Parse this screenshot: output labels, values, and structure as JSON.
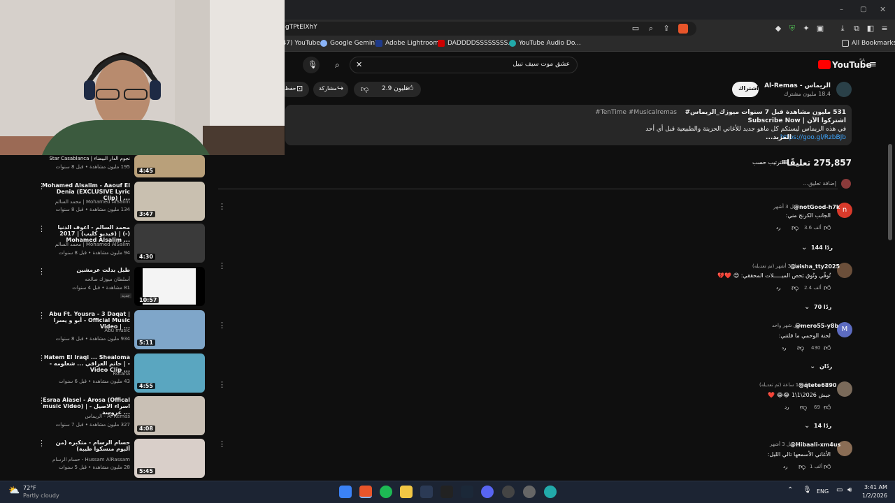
{
  "browser": {
    "url": "gTPtElXhY",
    "bookmarks": [
      {
        "label": "(47) YouTube",
        "color": "#ff0000"
      },
      {
        "label": "Google Gemini",
        "color": "#8ab4f8"
      },
      {
        "label": "Adobe Lightroom",
        "color": "#1e3a8a"
      },
      {
        "label": "DADDDDSSSSSSSS...",
        "color": "#c00"
      },
      {
        "label": "YouTube Audio Do...",
        "color": "#2aa"
      }
    ],
    "all_bookmarks": "All Bookmarks"
  },
  "yt_header": {
    "logo_text": "YouTube",
    "region": "SA",
    "search_value": "عشق موت سيف نبيل",
    "search_icon": "search-icon"
  },
  "channel": {
    "name": "الريماس - Al-Remas",
    "subscribers": "18.4 مليون مشترك",
    "subscribe_label": "اشتراك",
    "likes": "2.9 مليون",
    "share_label": "مشاركة",
    "save_label": "حفظ"
  },
  "description": {
    "stats": "531 مليون مشاهدة  قبل 7 سنوات  ميوزك_الريماس#",
    "hashtags": "#TenTime #Musicalremas",
    "line2": "اشتركوا الآن | Subscribe Now",
    "line3": "في هذه الريماس ليستكم كل ماهو جديد للأغاني الحزينة والطبيعية قبل أي أحد",
    "link": "https://goo.gl/RzbBJb",
    "more": "...المزيد"
  },
  "comments_header": {
    "count": "275,857 تعليقًا",
    "sort_label": "الترتيب حسب",
    "add_placeholder": "إضافة تعليق..."
  },
  "comments": [
    {
      "author": "@notGood-h7k",
      "time": "قبل 3 أشهر",
      "text": "الجانب الكرنج مني:",
      "likes": "3.6 ألف",
      "replies": "144 ردًا",
      "avatar_letter": "n",
      "avatar_color": "#d93a2b"
    },
    {
      "author": "@aisha_tty2025",
      "time": "قبل 3 أشهر (تم تعديله)",
      "text": "تُوفّي وتُوق بَحص الميـــــلات المحققي: 😍 ❤️💔",
      "likes": "2.4 ألف",
      "replies": "70 ردًا",
      "avatar_letter": "",
      "avatar_color": "#6b4f3a"
    },
    {
      "author": "@mero55-y8b",
      "time": "قبل شهر واحد",
      "text": "لحنة الوحمي ما قلتني:",
      "likes": "430",
      "replies": "ردّان",
      "avatar_letter": "M",
      "avatar_color": "#5c6bc0"
    },
    {
      "author": "@qtete6890",
      "time": "قبل 13 ساعة (تم تعديله)",
      "text": "جيش 2026\\1\\1 😂😂 ❤️",
      "likes": "69",
      "replies": "14 ردًا",
      "avatar_letter": "",
      "avatar_color": "#7a6a5a"
    },
    {
      "author": "@Hibaali-xm4us",
      "time": "قبل 3 أشهر",
      "text": "الأغاني الأسمعها تالي الليل:",
      "likes": "1 ألف",
      "replies": "",
      "avatar_letter": "",
      "avatar_color": "#8a6d55"
    }
  ],
  "reply_label": "رد",
  "sidebar_videos": [
    {
      "title": "نجوم الدار البيضاء | Star Casablanca",
      "channel": "",
      "meta": "195 مليون مشاهدة • قبل 8 سنوات",
      "duration": "4:45",
      "thumb": "#b9a07a"
    },
    {
      "title": "Mohamed Alsalim - Aaouf El Denia (EXCLUSIVE Lyric Clip) | ...",
      "channel": "محمد السالم | Mohamed AlSalim",
      "meta": "134 مليون مشاهدة • قبل 8 سنوات",
      "duration": "3:47",
      "thumb": "#c9c0b0"
    },
    {
      "title": "محمد السالم - اعوف الدنيا (فيديو كليب) | 2017 | (-) Mohamed Alsalim ...",
      "channel": "محمد السالم | Mohamed AlSalim",
      "meta": "94 مليون مشاهدة • قبل 8 سنوات",
      "duration": "4:30",
      "thumb": "#3a3a3a"
    },
    {
      "title": "طبل بدلت عرمشين",
      "channel": "أسلطان ميوزك صالحه",
      "meta": "81 مشاهدة • قبل 4 سنوات",
      "duration": "10:57",
      "thumb": "#f4f4f4",
      "badge": "جديد"
    },
    {
      "title": "Abu Ft. Yousra - 3 Daqat | أبو و يسرا - Official Music Video | ...",
      "channel": "Abu music",
      "meta": "934 مليون مشاهدة • قبل 8 سنوات",
      "duration": "5:11",
      "thumb": "#7fa6c9"
    },
    {
      "title": "Hatem El Iraqi ... Shealoma - حاتم العراقي ... شعلومه | - Video Clip ...",
      "channel": "Rotana",
      "meta": "43 مليون مشاهدة • قبل 6 سنوات",
      "duration": "4:55",
      "thumb": "#5aa6c0"
    },
    {
      "title": "Esraa Alasel - Arosa (Offical music Video) | اسراء الاصيل - عروسة ...",
      "channel": "الريماس - Al-Remas",
      "meta": "327 مليون مشاهدة • قبل 7 سنوات",
      "duration": "4:08",
      "thumb": "#c9c0b5"
    },
    {
      "title": "حسام الرسام - متكبره (من ألبوم منسكوا طيبة)",
      "channel": "حسام الرسام - Hussam AlRassam",
      "meta": "28 مليون مشاهدة • قبل 5 سنوات",
      "duration": "5:45",
      "thumb": "#d9cfc9"
    }
  ],
  "taskbar": {
    "weather_temp": "72°F",
    "weather_desc": "Partly cloudy",
    "lang": "ENG",
    "time": "3:41 AM",
    "date": "1/2/2026"
  }
}
